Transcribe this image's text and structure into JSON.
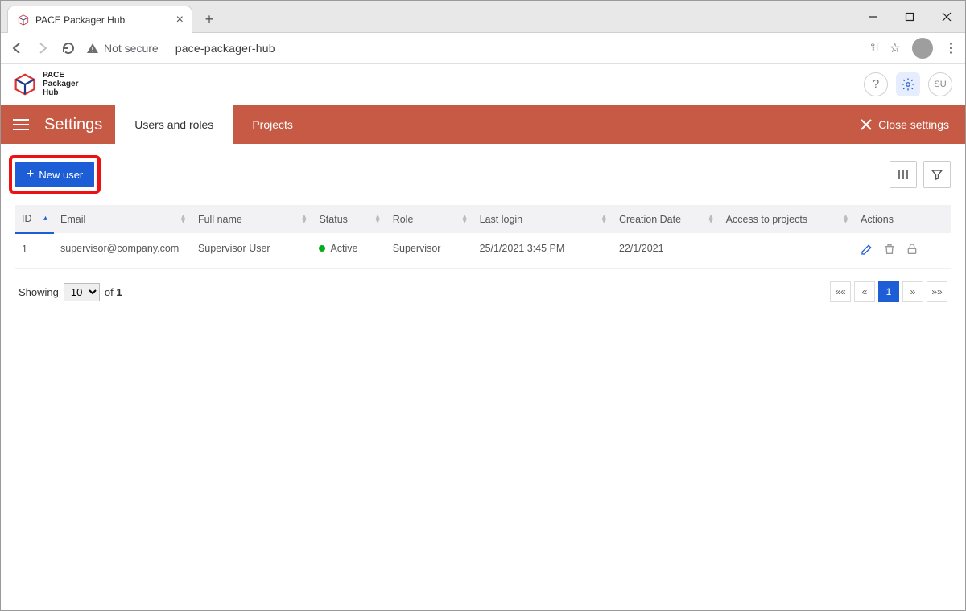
{
  "browser": {
    "tab_title": "PACE Packager Hub",
    "not_secure": "Not secure",
    "url": "pace-packager-hub"
  },
  "brand": {
    "line1": "PACE",
    "line2": "Packager",
    "line3": "Hub"
  },
  "header": {
    "user_badge": "SU"
  },
  "settings": {
    "title": "Settings",
    "tab_users": "Users and roles",
    "tab_projects": "Projects",
    "close": "Close settings"
  },
  "toolbar": {
    "new_user": "New user"
  },
  "columns": {
    "id": "ID",
    "email": "Email",
    "fullname": "Full name",
    "status": "Status",
    "role": "Role",
    "lastlogin": "Last login",
    "creation": "Creation Date",
    "access": "Access to projects",
    "actions": "Actions"
  },
  "rows": [
    {
      "id": "1",
      "email": "supervisor@company.com",
      "fullname": "Supervisor User",
      "status": "Active",
      "role": "Supervisor",
      "lastlogin": "25/1/2021 3:45 PM",
      "creation": "22/1/2021",
      "access": ""
    }
  ],
  "pagination": {
    "showing": "Showing",
    "of": "of",
    "total": "1",
    "pagesize": "10",
    "first": "««",
    "prev": "«",
    "current": "1",
    "next": "»",
    "last": "»»"
  }
}
